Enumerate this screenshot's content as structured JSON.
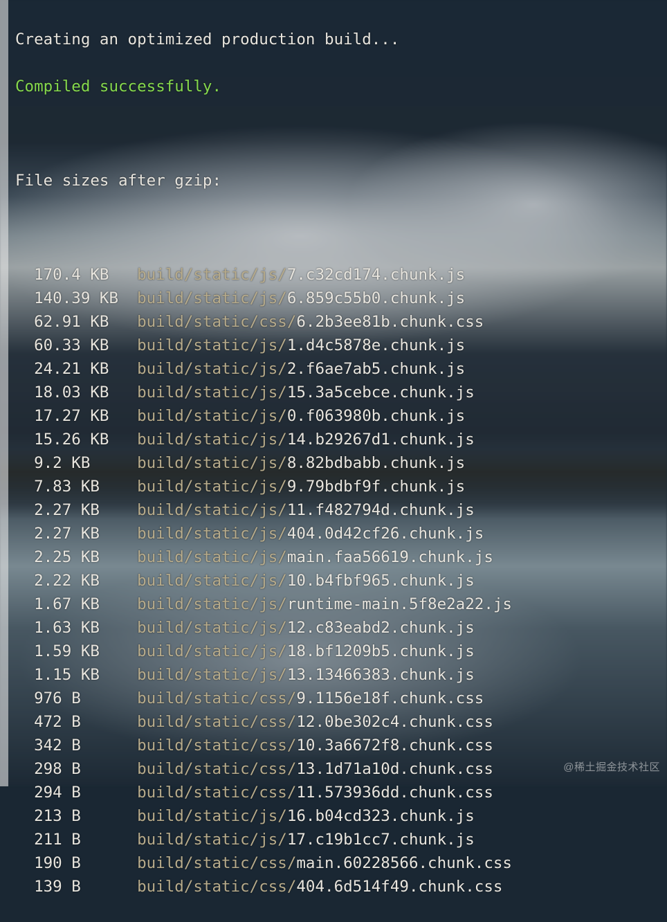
{
  "header": {
    "line1": "Creating an optimized production build...",
    "line2": "Compiled successfully.",
    "line3": "File sizes after gzip:"
  },
  "files": [
    {
      "size": "170.4 KB",
      "dir": "build/static/js/",
      "name": "7.c32cd174.chunk.js"
    },
    {
      "size": "140.39 KB",
      "dir": "build/static/js/",
      "name": "6.859c55b0.chunk.js"
    },
    {
      "size": "62.91 KB",
      "dir": "build/static/css/",
      "name": "6.2b3ee81b.chunk.css"
    },
    {
      "size": "60.33 KB",
      "dir": "build/static/js/",
      "name": "1.d4c5878e.chunk.js"
    },
    {
      "size": "24.21 KB",
      "dir": "build/static/js/",
      "name": "2.f6ae7ab5.chunk.js"
    },
    {
      "size": "18.03 KB",
      "dir": "build/static/js/",
      "name": "15.3a5cebce.chunk.js"
    },
    {
      "size": "17.27 KB",
      "dir": "build/static/js/",
      "name": "0.f063980b.chunk.js"
    },
    {
      "size": "15.26 KB",
      "dir": "build/static/js/",
      "name": "14.b29267d1.chunk.js"
    },
    {
      "size": "9.2 KB",
      "dir": "build/static/js/",
      "name": "8.82bdbabb.chunk.js"
    },
    {
      "size": "7.83 KB",
      "dir": "build/static/js/",
      "name": "9.79bdbf9f.chunk.js"
    },
    {
      "size": "2.27 KB",
      "dir": "build/static/js/",
      "name": "11.f482794d.chunk.js"
    },
    {
      "size": "2.27 KB",
      "dir": "build/static/js/",
      "name": "404.0d42cf26.chunk.js"
    },
    {
      "size": "2.25 KB",
      "dir": "build/static/js/",
      "name": "main.faa56619.chunk.js"
    },
    {
      "size": "2.22 KB",
      "dir": "build/static/js/",
      "name": "10.b4fbf965.chunk.js"
    },
    {
      "size": "1.67 KB",
      "dir": "build/static/js/",
      "name": "runtime-main.5f8e2a22.js"
    },
    {
      "size": "1.63 KB",
      "dir": "build/static/js/",
      "name": "12.c83eabd2.chunk.js"
    },
    {
      "size": "1.59 KB",
      "dir": "build/static/js/",
      "name": "18.bf1209b5.chunk.js"
    },
    {
      "size": "1.15 KB",
      "dir": "build/static/js/",
      "name": "13.13466383.chunk.js"
    },
    {
      "size": "976 B",
      "dir": "build/static/css/",
      "name": "9.1156e18f.chunk.css"
    },
    {
      "size": "472 B",
      "dir": "build/static/css/",
      "name": "12.0be302c4.chunk.css"
    },
    {
      "size": "342 B",
      "dir": "build/static/css/",
      "name": "10.3a6672f8.chunk.css"
    },
    {
      "size": "298 B",
      "dir": "build/static/css/",
      "name": "13.1d71a10d.chunk.css"
    },
    {
      "size": "294 B",
      "dir": "build/static/css/",
      "name": "11.573936dd.chunk.css"
    },
    {
      "size": "213 B",
      "dir": "build/static/js/",
      "name": "16.b04cd323.chunk.js"
    },
    {
      "size": "211 B",
      "dir": "build/static/js/",
      "name": "17.c19b1cc7.chunk.js"
    },
    {
      "size": "190 B",
      "dir": "build/static/css/",
      "name": "main.60228566.chunk.css"
    },
    {
      "size": "139 B",
      "dir": "build/static/css/",
      "name": "404.6d514f49.chunk.css"
    }
  ],
  "watermark": "@稀土掘金技术社区"
}
